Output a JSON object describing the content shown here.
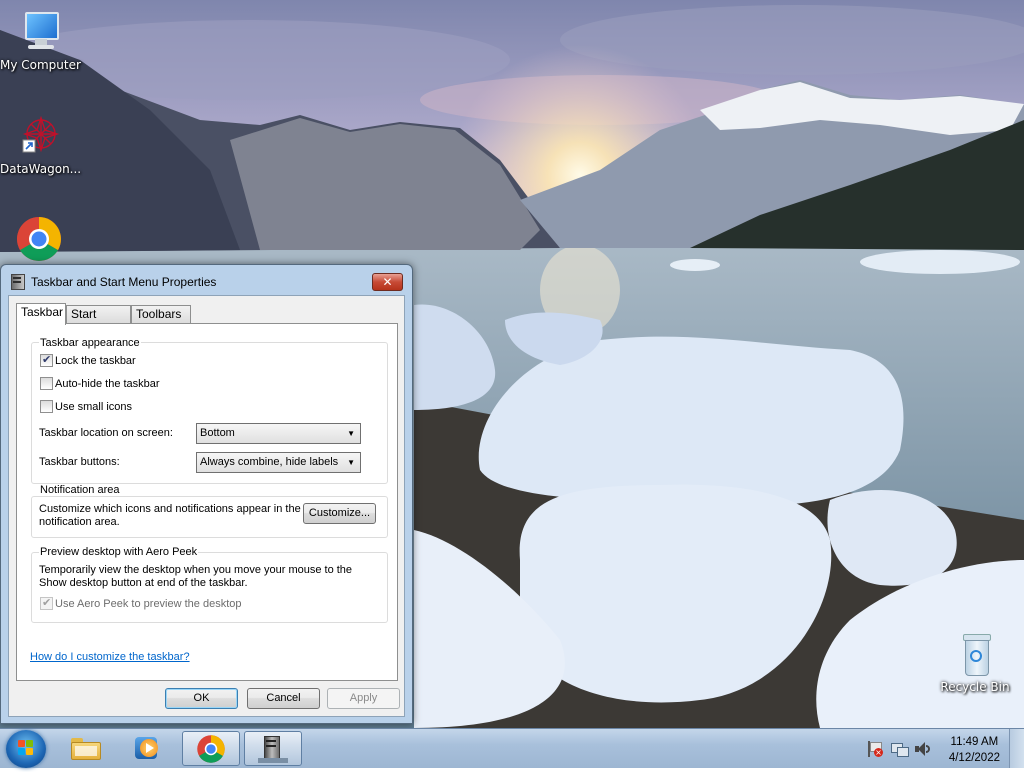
{
  "desktop": {
    "icons": [
      {
        "label": "My Computer"
      },
      {
        "label": "DataWagon..."
      },
      {
        "label": ""
      },
      {
        "label": "Recycle Bin"
      }
    ]
  },
  "dialog": {
    "title": "Taskbar and Start Menu Properties",
    "close_label": "✕",
    "tabs": [
      {
        "label": "Taskbar",
        "active": true
      },
      {
        "label": "Start Menu",
        "active": false
      },
      {
        "label": "Toolbars",
        "active": false
      }
    ],
    "appearance": {
      "heading": "Taskbar appearance",
      "options": [
        {
          "label": "Lock the taskbar",
          "checked": true
        },
        {
          "label": "Auto-hide the taskbar",
          "checked": false
        },
        {
          "label": "Use small icons",
          "checked": false
        }
      ],
      "location_label": "Taskbar location on screen:",
      "location_value": "Bottom",
      "buttons_label": "Taskbar buttons:",
      "buttons_value": "Always combine, hide labels"
    },
    "notification": {
      "heading": "Notification area",
      "description_line1": "Customize which icons and notifications appear in the",
      "description_line2": "notification area.",
      "customize_label": "Customize..."
    },
    "aero_peek": {
      "heading": "Preview desktop with Aero Peek",
      "description_line1": "Temporarily view the desktop when you move your mouse to the",
      "description_line2": "Show desktop button at end of the taskbar.",
      "option_label": "Use Aero Peek to preview the desktop",
      "option_checked": true,
      "option_disabled": true
    },
    "help_link": "How do I customize the taskbar?",
    "buttons": {
      "ok": "OK",
      "cancel": "Cancel",
      "apply": "Apply"
    }
  },
  "taskbar": {
    "pinned": [
      {
        "icon": "folder-icon"
      },
      {
        "icon": "media-player-icon"
      },
      {
        "icon": "chrome-icon"
      },
      {
        "icon": "properties-window-icon"
      }
    ],
    "clock": {
      "time": "11:49 AM",
      "date": "4/12/2022"
    }
  }
}
